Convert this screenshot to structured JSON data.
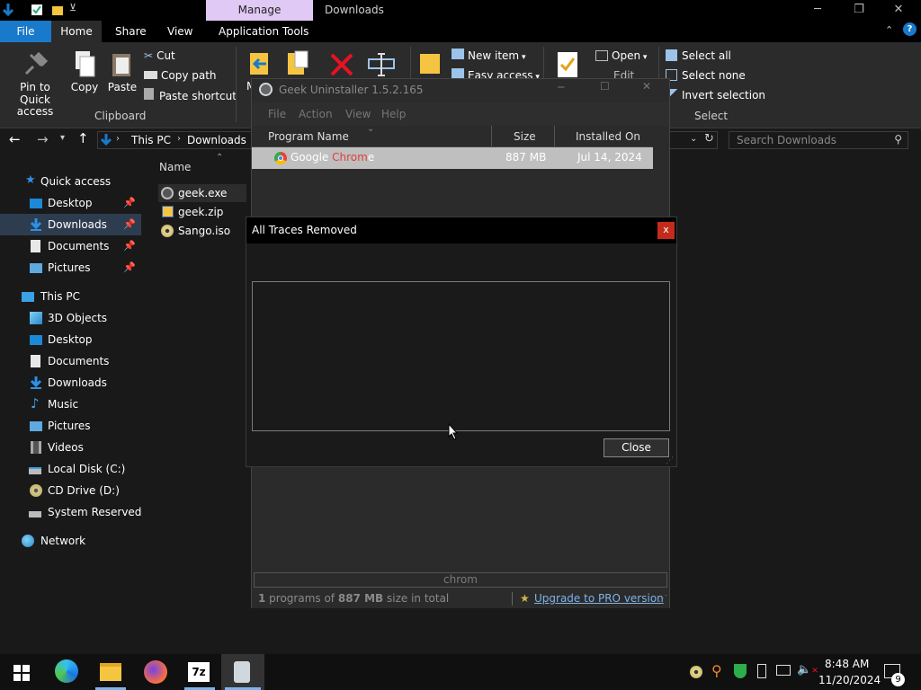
{
  "explorer": {
    "window_title": "Downloads",
    "context_tab": "Manage",
    "tabs": [
      "File",
      "Home",
      "Share",
      "View",
      "Application Tools"
    ],
    "ribbon": {
      "pin": "Pin to Quick\naccess",
      "pin1": "Pin to Quick",
      "pin2": "access",
      "copy": "Copy",
      "paste": "Paste",
      "cut": "Cut",
      "copy_path": "Copy path",
      "paste_shortcut": "Paste shortcut",
      "clipboard": "Clipboard",
      "new_item": "New item",
      "easy_access": "Easy access",
      "open": "Open",
      "edit": "Edit",
      "move_partial": "M",
      "select_all": "Select all",
      "select_none": "Select none",
      "invert_selection": "Invert selection",
      "select": "Select"
    },
    "breadcrumb": [
      "This PC",
      "Downloads"
    ],
    "search_placeholder": "Search Downloads",
    "column_name": "Name",
    "sidebar": [
      {
        "label": "Quick access",
        "icon": "star-icon"
      },
      {
        "label": "Desktop",
        "icon": "desktop-icon",
        "pinned": true
      },
      {
        "label": "Downloads",
        "icon": "download-icon",
        "pinned": true,
        "selected": true
      },
      {
        "label": "Documents",
        "icon": "document-icon",
        "pinned": true
      },
      {
        "label": "Pictures",
        "icon": "pictures-icon",
        "pinned": true
      },
      {
        "label": "This PC",
        "icon": "computer-icon"
      },
      {
        "label": "3D Objects",
        "icon": "cube-icon"
      },
      {
        "label": "Desktop",
        "icon": "desktop-icon"
      },
      {
        "label": "Documents",
        "icon": "document-icon"
      },
      {
        "label": "Downloads",
        "icon": "download-icon"
      },
      {
        "label": "Music",
        "icon": "music-icon"
      },
      {
        "label": "Pictures",
        "icon": "pictures-icon"
      },
      {
        "label": "Videos",
        "icon": "video-icon"
      },
      {
        "label": "Local Disk (C:)",
        "icon": "disk-icon"
      },
      {
        "label": "CD Drive (D:)",
        "icon": "cd-icon"
      },
      {
        "label": "System Reserved (M",
        "icon": "drive-icon"
      },
      {
        "label": "Network",
        "icon": "network-icon"
      }
    ],
    "files": [
      "geek.exe",
      "geek.zip",
      "Sango.iso"
    ]
  },
  "geek": {
    "title": "Geek Uninstaller 1.5.2.165",
    "menu": [
      "File",
      "Action",
      "View",
      "Help"
    ],
    "columns": [
      "Program Name",
      "Size",
      "Installed On"
    ],
    "row": {
      "name_a": "Google ",
      "name_b": "Chrom",
      "name_c": "e",
      "size": "887 MB",
      "date": "Jul 14, 2024"
    },
    "filter": "chrom",
    "status_count": "1",
    "status_mid": " programs of ",
    "status_size": "887 MB",
    "status_end": " size in total",
    "upgrade": "Upgrade to PRO version"
  },
  "dialog": {
    "title": "All Traces Removed",
    "close_x": "x",
    "close_button": "Close"
  },
  "taskbar": {
    "time": "8:48 AM",
    "date": "11/20/2024",
    "notifications": "9"
  },
  "colors": {
    "accent": "#1979ca",
    "manage_tab": "#e1c9f5",
    "chrome_highlight": "#e0413a",
    "dialog_close": "#c42b1c"
  }
}
